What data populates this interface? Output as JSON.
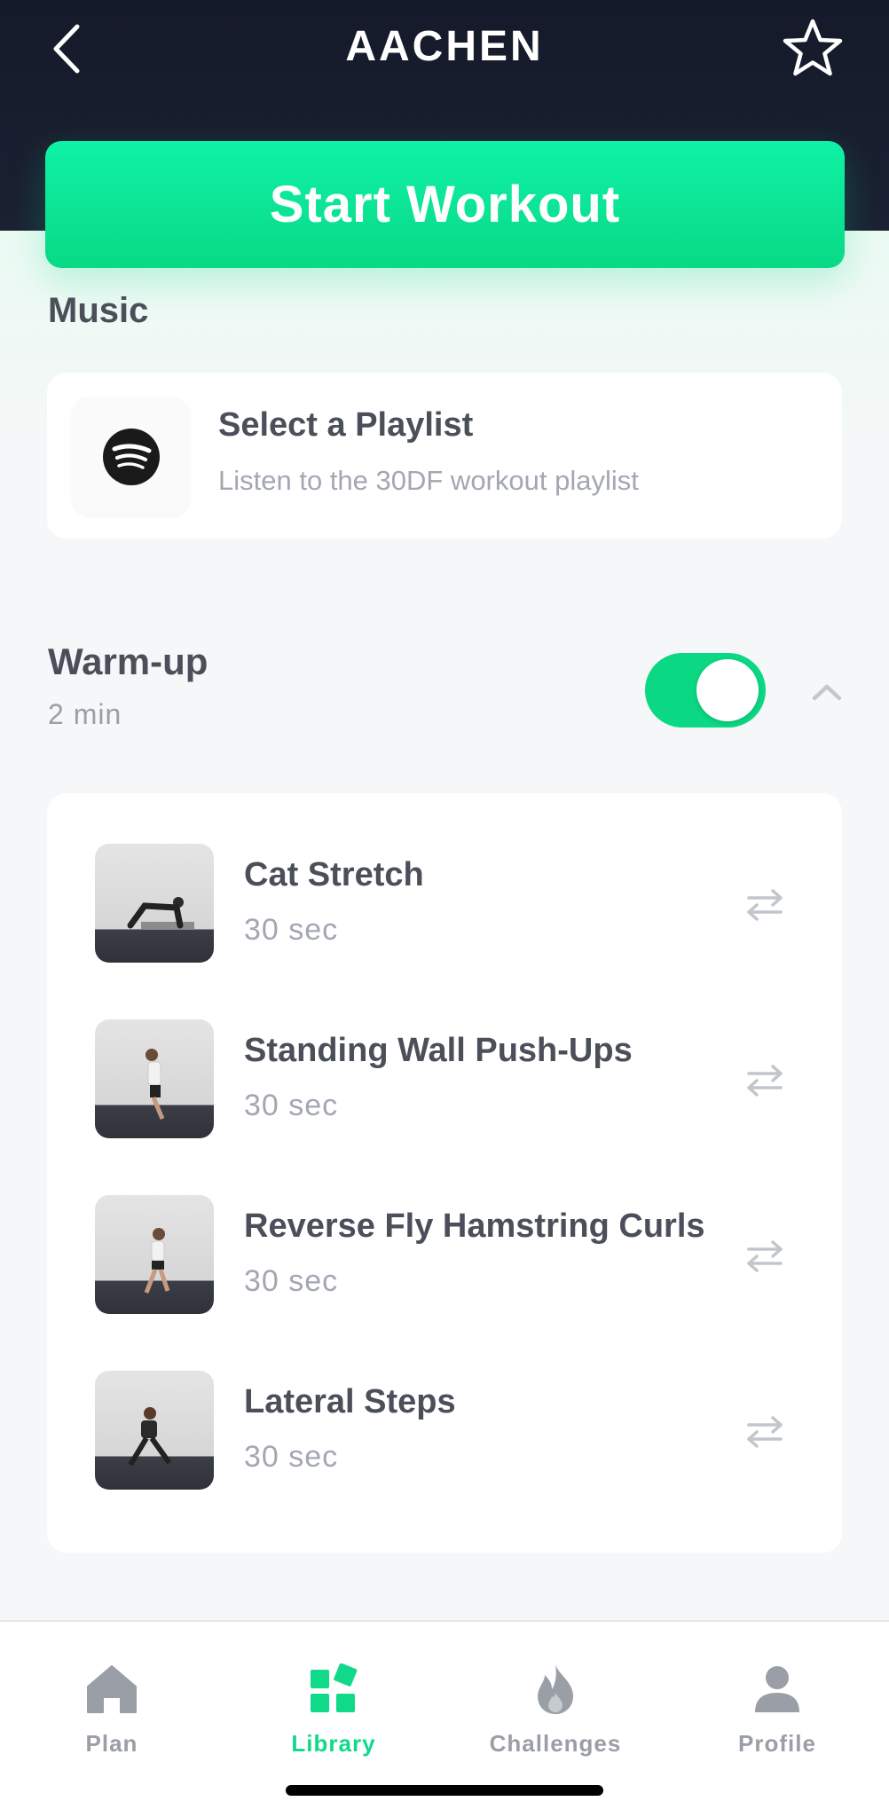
{
  "header": {
    "title": "AACHEN",
    "back_icon": "chevron-left-icon",
    "favorite_icon": "star-outline-icon"
  },
  "start_button": {
    "label": "Start Workout"
  },
  "music": {
    "section_title": "Music",
    "icon": "spotify-icon",
    "title": "Select a Playlist",
    "subtitle": "Listen to the 30DF workout playlist"
  },
  "warmup": {
    "title": "Warm-up",
    "duration": "2 min",
    "toggle_on": true,
    "collapse_icon": "chevron-up-icon",
    "exercises": [
      {
        "name": "Cat Stretch",
        "duration": "30 sec",
        "swap_icon": "swap-arrows-icon"
      },
      {
        "name": "Standing Wall Push-Ups",
        "duration": "30 sec",
        "swap_icon": "swap-arrows-icon"
      },
      {
        "name": "Reverse Fly Hamstring Curls",
        "duration": "30 sec",
        "swap_icon": "swap-arrows-icon"
      },
      {
        "name": "Lateral Steps",
        "duration": "30 sec",
        "swap_icon": "swap-arrows-icon"
      }
    ]
  },
  "tabbar": {
    "tabs": [
      {
        "label": "Plan",
        "icon": "home-icon",
        "active": false
      },
      {
        "label": "Library",
        "icon": "library-grid-icon",
        "active": true
      },
      {
        "label": "Challenges",
        "icon": "flame-icon",
        "active": false
      },
      {
        "label": "Profile",
        "icon": "person-icon",
        "active": false
      }
    ]
  },
  "colors": {
    "accent": "#10d98a",
    "header_bg": "#171c2d",
    "text_dark": "#4b4f5a",
    "text_muted": "#a3a7b2"
  }
}
